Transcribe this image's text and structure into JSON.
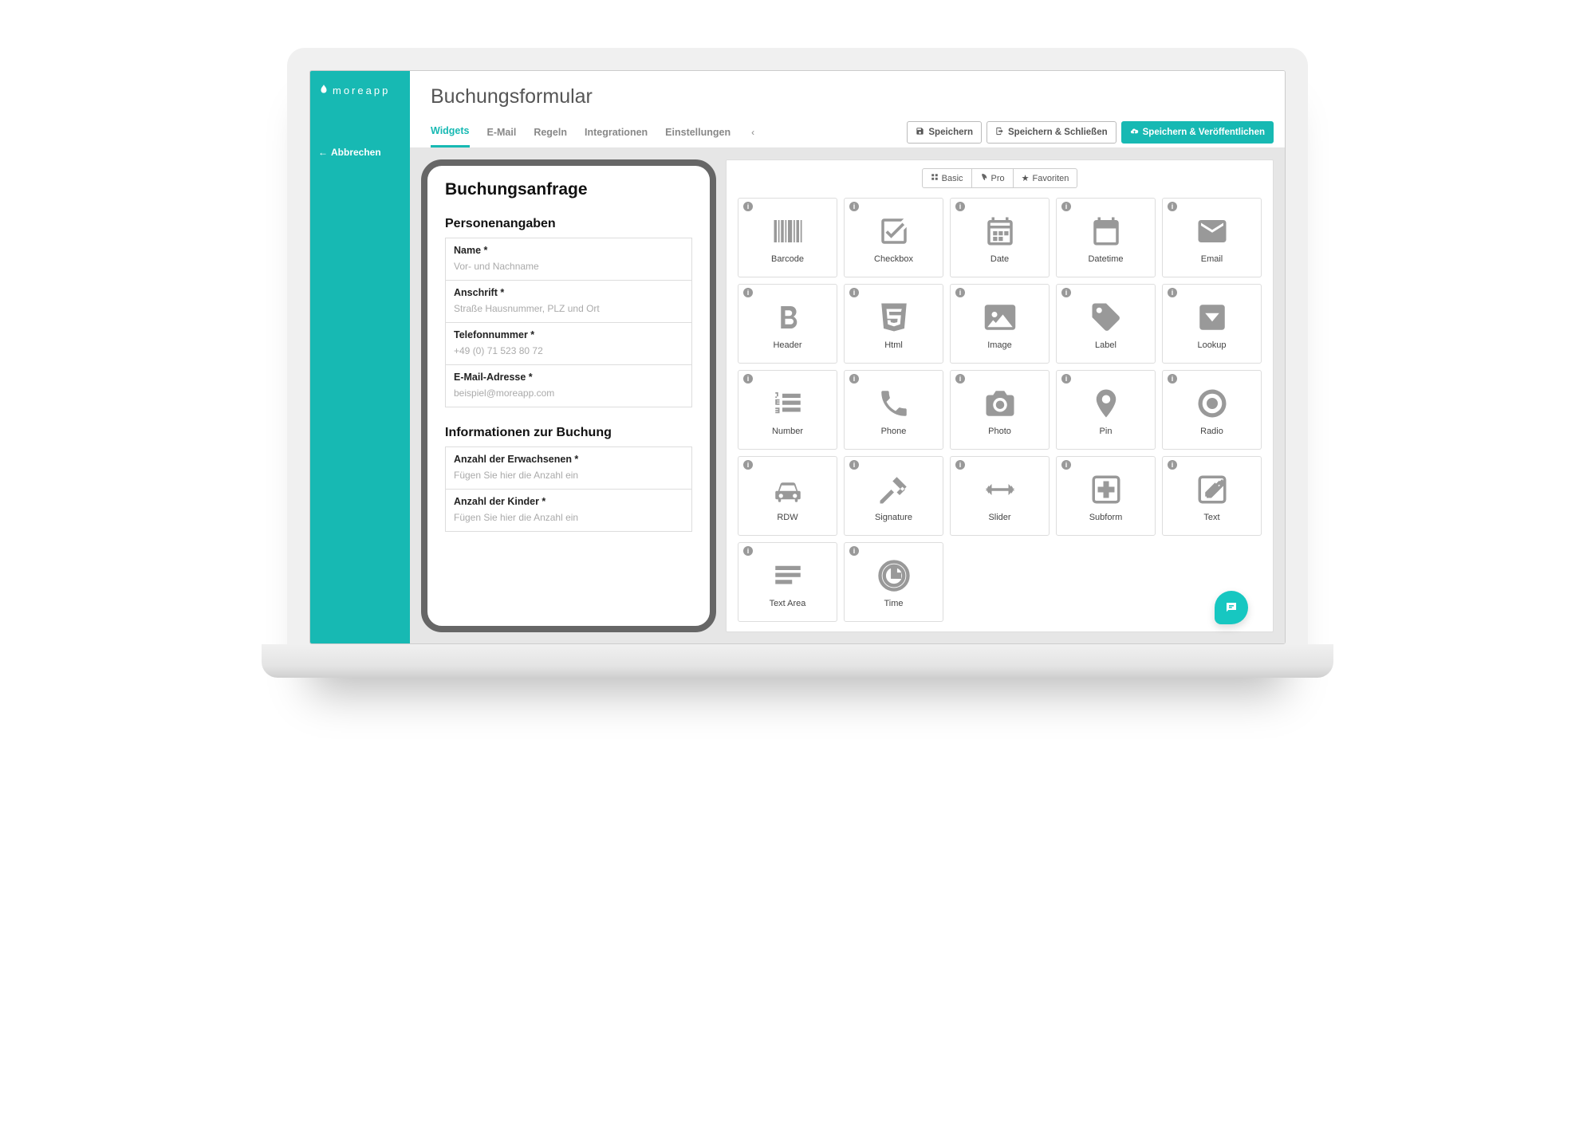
{
  "brand": "moreapp",
  "back_label": "Abbrechen",
  "page_title": "Buchungsformular",
  "tabs": {
    "widgets": "Widgets",
    "email": "E-Mail",
    "rules": "Regeln",
    "integrations": "Integrationen",
    "settings": "Einstellungen"
  },
  "actions": {
    "save": "Speichern",
    "save_close": "Speichern & Schließen",
    "save_publish": "Speichern & Veröffentlichen"
  },
  "preview": {
    "title": "Buchungsanfrage",
    "section1": "Personenangaben",
    "fields1": [
      {
        "label": "Name *",
        "placeholder": "Vor- und Nachname"
      },
      {
        "label": "Anschrift *",
        "placeholder": "Straße Hausnummer, PLZ und Ort"
      },
      {
        "label": "Telefonnummer *",
        "placeholder": "+49 (0) 71 523 80 72"
      },
      {
        "label": "E-Mail-Adresse *",
        "placeholder": "beispiel@moreapp.com"
      }
    ],
    "section2": "Informationen zur Buchung",
    "fields2": [
      {
        "label": "Anzahl der Erwachsenen *",
        "placeholder": "Fügen Sie hier die Anzahl ein"
      },
      {
        "label": "Anzahl der Kinder *",
        "placeholder": "Fügen Sie hier die Anzahl ein"
      }
    ]
  },
  "filters": {
    "basic": "Basic",
    "pro": "Pro",
    "favorites": "Favoriten"
  },
  "widgets": [
    {
      "name": "Barcode",
      "icon": "barcode"
    },
    {
      "name": "Checkbox",
      "icon": "checkbox"
    },
    {
      "name": "Date",
      "icon": "calendar"
    },
    {
      "name": "Datetime",
      "icon": "calendar-blank"
    },
    {
      "name": "Email",
      "icon": "envelope"
    },
    {
      "name": "Header",
      "icon": "bold"
    },
    {
      "name": "Html",
      "icon": "html5"
    },
    {
      "name": "Image",
      "icon": "image"
    },
    {
      "name": "Label",
      "icon": "tag"
    },
    {
      "name": "Lookup",
      "icon": "dropdown"
    },
    {
      "name": "Number",
      "icon": "list-numbered"
    },
    {
      "name": "Phone",
      "icon": "phone"
    },
    {
      "name": "Photo",
      "icon": "camera"
    },
    {
      "name": "Pin",
      "icon": "pin"
    },
    {
      "name": "Radio",
      "icon": "radio"
    },
    {
      "name": "RDW",
      "icon": "car"
    },
    {
      "name": "Signature",
      "icon": "gavel"
    },
    {
      "name": "Slider",
      "icon": "slider"
    },
    {
      "name": "Subform",
      "icon": "plus-square"
    },
    {
      "name": "Text",
      "icon": "edit"
    },
    {
      "name": "Text Area",
      "icon": "lines"
    },
    {
      "name": "Time",
      "icon": "clock"
    }
  ]
}
